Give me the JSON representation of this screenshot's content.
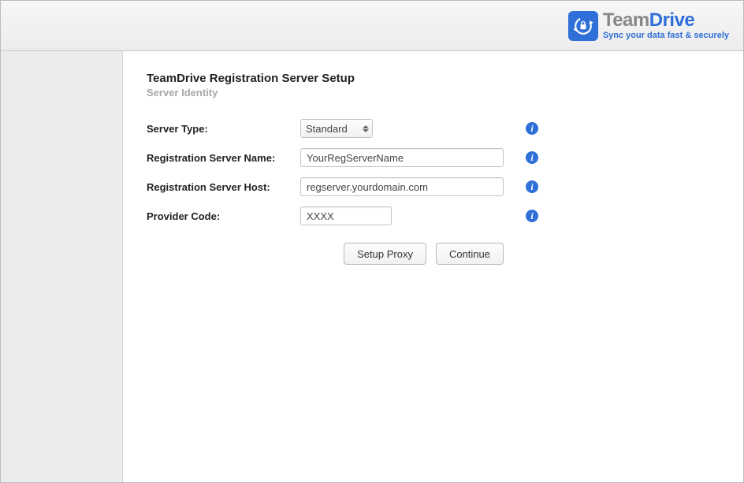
{
  "brand": {
    "name_part1": "Team",
    "name_part2": "Drive",
    "tagline": "Sync your data fast & securely"
  },
  "page": {
    "title": "TeamDrive Registration Server Setup",
    "subtitle": "Server Identity"
  },
  "form": {
    "server_type": {
      "label": "Server Type:",
      "value": "Standard"
    },
    "reg_server_name": {
      "label": "Registration Server Name:",
      "value": "YourRegServerName"
    },
    "reg_server_host": {
      "label": "Registration Server Host:",
      "value": "regserver.yourdomain.com"
    },
    "provider_code": {
      "label": "Provider Code:",
      "value": "XXXX"
    }
  },
  "buttons": {
    "setup_proxy": "Setup Proxy",
    "continue": "Continue"
  },
  "icons": {
    "info_glyph": "i"
  }
}
